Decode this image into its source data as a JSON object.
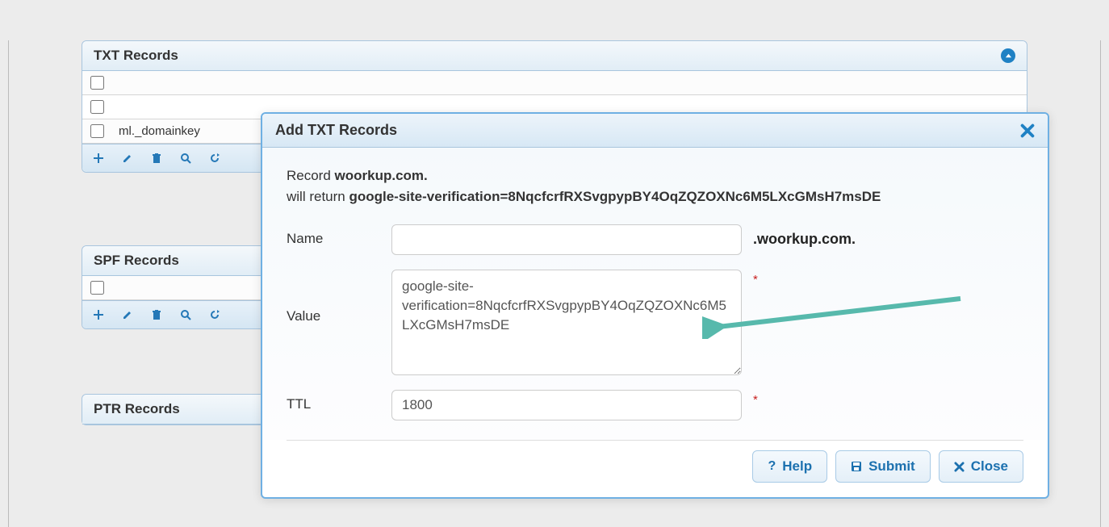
{
  "panels": {
    "txt": {
      "title": "TXT Records",
      "rows": [
        "",
        "",
        "ml._domainkey"
      ]
    },
    "spf": {
      "title": "SPF Records",
      "rows": [
        ""
      ]
    },
    "ptr": {
      "title": "PTR Records"
    }
  },
  "modal": {
    "title": "Add TXT Records",
    "info_prefix": "Record ",
    "info_domain": "woorkup.com.",
    "info_mid": "will return ",
    "info_value": "google-site-verification=8NqcfcrfRXSvgpypBY4OqZQZOXNc6M5LXcGMsH7msDE",
    "name_label": "Name",
    "name_value": "",
    "name_suffix": ".woorkup.com.",
    "value_label": "Value",
    "value_text": "google-site-verification=8NqcfcrfRXSvgpypBY4OqZQZOXNc6M5LXcGMsH7msDE",
    "ttl_label": "TTL",
    "ttl_value": "1800"
  },
  "buttons": {
    "help": "Help",
    "submit": "Submit",
    "close": "Close"
  }
}
